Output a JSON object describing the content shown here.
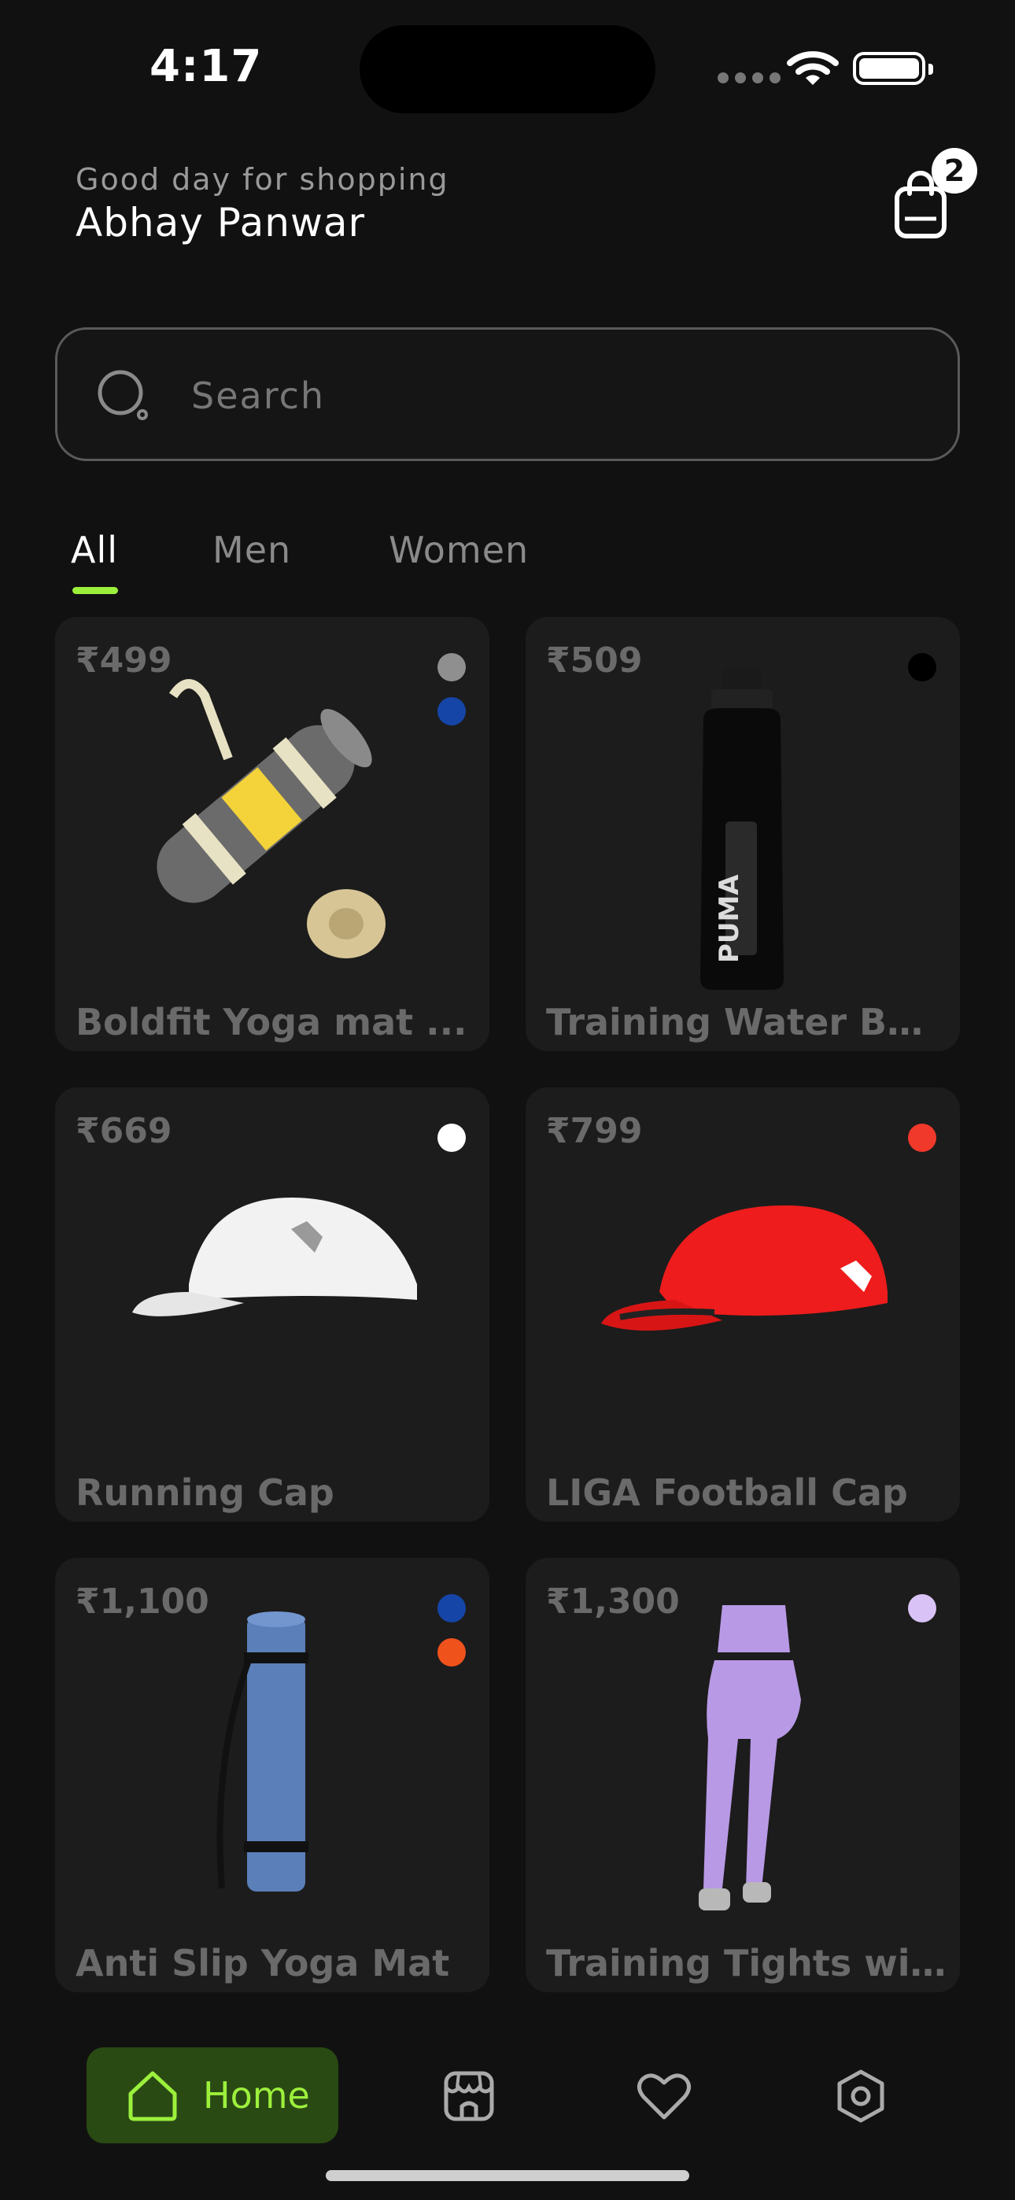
{
  "status_bar": {
    "time": "4:17"
  },
  "header": {
    "greeting": "Good day for shopping",
    "user_name": "Abhay Panwar",
    "cart_count": "2"
  },
  "search": {
    "placeholder": "Search"
  },
  "tabs": [
    {
      "label": "All",
      "active": true
    },
    {
      "label": "Men",
      "active": false
    },
    {
      "label": "Women",
      "active": false
    }
  ],
  "accent_color": "#9cf03c",
  "products": [
    {
      "price": "₹499",
      "name": "Boldfit Yoga mat ...",
      "colors": [
        "#8f8f8f",
        "#1545a6"
      ]
    },
    {
      "price": "₹509",
      "name": "Training Water Bot...",
      "colors": [
        "#000000"
      ]
    },
    {
      "price": "₹669",
      "name": "Running Cap",
      "colors": [
        "#ffffff"
      ]
    },
    {
      "price": "₹799",
      "name": "LIGA Football Cap",
      "colors": [
        "#f0392b"
      ]
    },
    {
      "price": "₹1,100",
      "name": "Anti Slip Yoga Mat",
      "colors": [
        "#1545a6",
        "#f0521c"
      ]
    },
    {
      "price": "₹1,300",
      "name": "Training Tights wit...",
      "colors": [
        "#d9c2f5"
      ]
    }
  ],
  "nav": {
    "home_label": "Home",
    "items": [
      "home-icon",
      "store-icon",
      "heart-icon",
      "settings-icon"
    ]
  }
}
